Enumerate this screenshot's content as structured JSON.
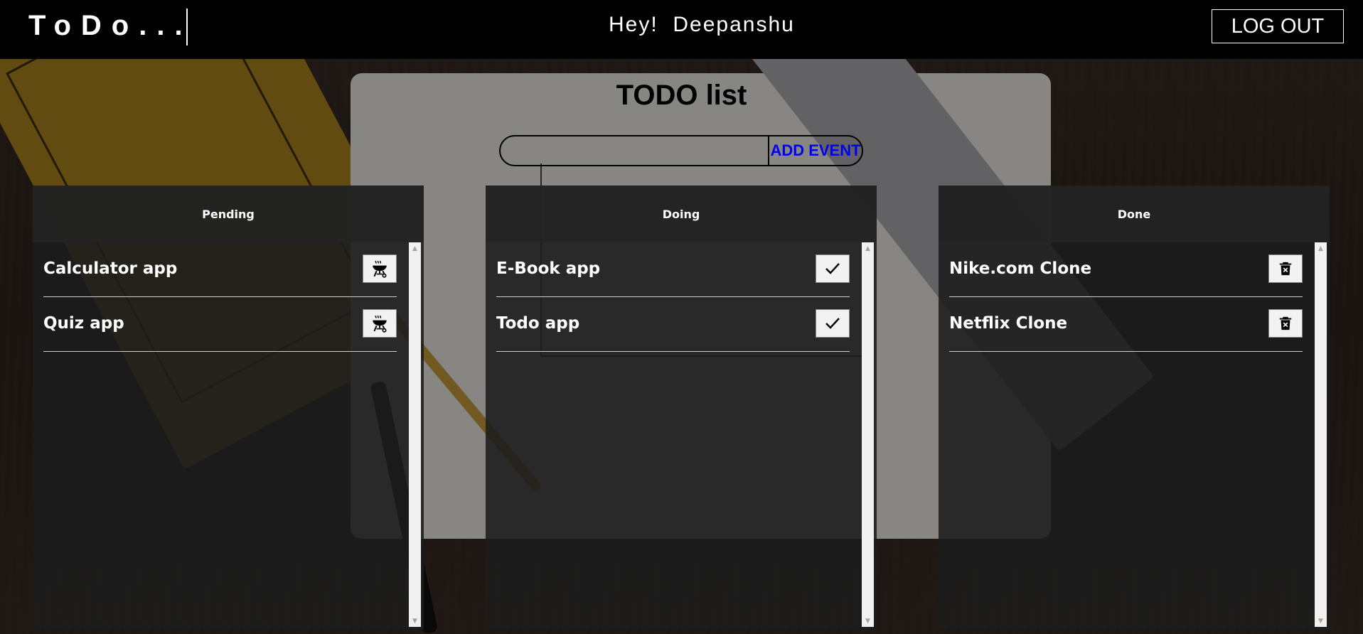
{
  "header": {
    "logo": "ToDo...",
    "greeting": "Hey!  Deepanshu",
    "logout_label": "LOG OUT"
  },
  "main": {
    "title": "TODO list",
    "add_event": {
      "input_value": "",
      "placeholder": "",
      "button_label": "ADD EVENT"
    }
  },
  "columns": [
    {
      "title": "Pending",
      "action_icon": "grill-icon",
      "items": [
        {
          "label": "Calculator app"
        },
        {
          "label": "Quiz app"
        }
      ]
    },
    {
      "title": "Doing",
      "action_icon": "check-icon",
      "items": [
        {
          "label": "E-Book app"
        },
        {
          "label": "Todo app"
        }
      ]
    },
    {
      "title": "Done",
      "action_icon": "trash-icon",
      "items": [
        {
          "label": "Nike.com Clone"
        },
        {
          "label": "Netflix Clone"
        }
      ]
    }
  ],
  "colors": {
    "header_bg": "#000000",
    "add_button_text": "#0000ee",
    "column_bg": "#1c1c1c"
  }
}
